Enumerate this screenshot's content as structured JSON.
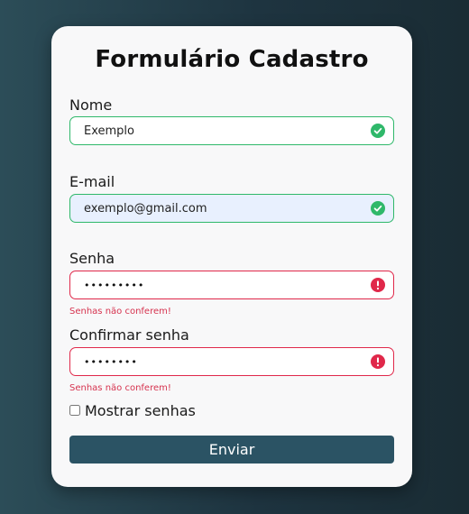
{
  "form": {
    "title": "Formulário Cadastro",
    "name_label": "Nome",
    "name_value": "Exemplo",
    "email_label": "E-mail",
    "email_value": "exemplo@gmail.com",
    "password_label": "Senha",
    "password_value": "•••••••••",
    "password_error": "Senhas não conferem!",
    "confirm_label": "Confirmar senha",
    "confirm_value": "••••••••",
    "confirm_error": "Senhas não conferem!",
    "show_passwords_label": "Mostrar senhas",
    "show_passwords_checked": false,
    "submit_label": "Enviar"
  },
  "icons": {
    "valid": "check-circle-icon",
    "invalid": "exclamation-circle-icon"
  },
  "colors": {
    "valid": "#2fb86a",
    "invalid": "#e0284a",
    "button": "#2b5364",
    "autofill_bg": "#e8f0fe"
  }
}
